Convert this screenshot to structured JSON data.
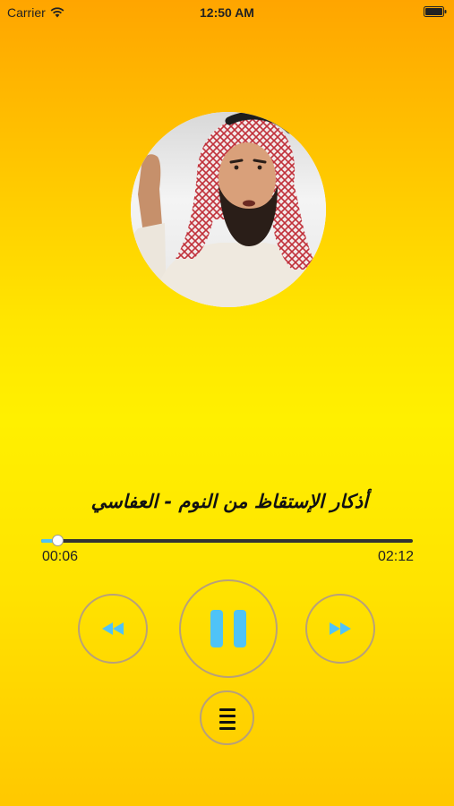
{
  "status_bar": {
    "carrier": "Carrier",
    "time": "12:50 AM",
    "wifi_icon": "wifi-icon",
    "battery_icon": "battery-icon"
  },
  "track": {
    "title": "أذكار الإستقاظ من النوم - العفاسي",
    "artwork_icon": "reciter-portrait"
  },
  "progress": {
    "elapsed": "00:06",
    "total": "02:12",
    "fraction": 0.045
  },
  "controls": {
    "rewind_icon": "rewind-icon",
    "pause_icon": "pause-icon",
    "forward_icon": "fast-forward-icon",
    "playlist_icon": "list-icon"
  },
  "colors": {
    "accent": "#4fc3f7",
    "button_border": "#b8a07a",
    "background_top": "#ffa500",
    "background_mid": "#fff000"
  }
}
